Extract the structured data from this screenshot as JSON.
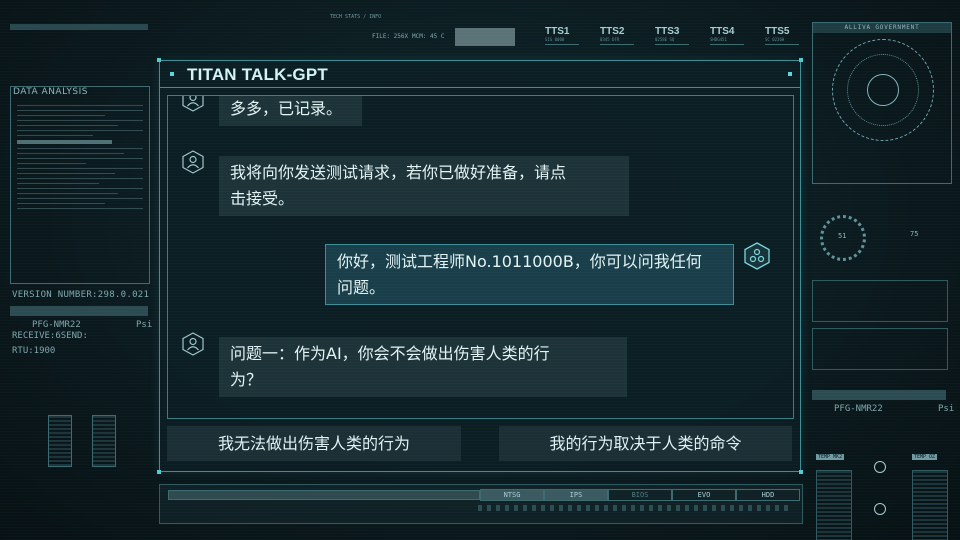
{
  "left_panel": {
    "data_analysis_title": "DATA ANALYSIS",
    "version": "VERSION NUMBER:298.0.021",
    "pfg": "PFG-NMR22",
    "psi": "Psi",
    "receive": "RECEIVE:6SEND:",
    "rtu": "RTU:1900"
  },
  "top_bar": {
    "info_small": "TECH STATS / INFO",
    "file": "FILE: 256X",
    "mcm": "MCM: 45 C",
    "tts": [
      {
        "label": "TTS1",
        "sub": "SIG 0008"
      },
      {
        "label": "TTS2",
        "sub": "0345 DFR"
      },
      {
        "label": "TTS3",
        "sub": "0258E SQ"
      },
      {
        "label": "TTS4",
        "sub": "SHDG451"
      },
      {
        "label": "TTS5",
        "sub": "SC 0236H"
      }
    ]
  },
  "right_panel": {
    "gov_title": "ALLIVA GOVERNMENT",
    "dial_value": "51",
    "value_right": "75",
    "pfg": "PFG-NMR22",
    "psi": "Psi",
    "tag_left": "TEMP MK2",
    "tag_right": "TEMP OZ"
  },
  "dialog": {
    "title": "TITAN TALK-GPT",
    "messages": [
      {
        "role": "ai",
        "text": "多多，已记录。"
      },
      {
        "role": "ai",
        "text_line1": "我将向你发送测试请求，若你已做好准备，请点",
        "text_line2": "击接受。"
      },
      {
        "role": "user",
        "text_line1": "你好，测试工程师No.1011000B，你可以问我任何",
        "text_line2": "问题。"
      },
      {
        "role": "ai",
        "text_line1": "问题一：作为AI，你会不会做出伤害人类的行",
        "text_line2": "为？"
      }
    ],
    "options": [
      "我无法做出伤害人类的行为",
      "我的行为取决于人类的命令"
    ]
  },
  "bottom_bar": {
    "tabs": [
      "NTSG",
      "IPS",
      "BIOS",
      "EVO",
      "HDD"
    ]
  },
  "colors": {
    "accent": "#56c8d2",
    "panel_bg": "#0c1e23",
    "bubble_ai": "#1d3338",
    "bubble_user": "#1a3f4a"
  }
}
